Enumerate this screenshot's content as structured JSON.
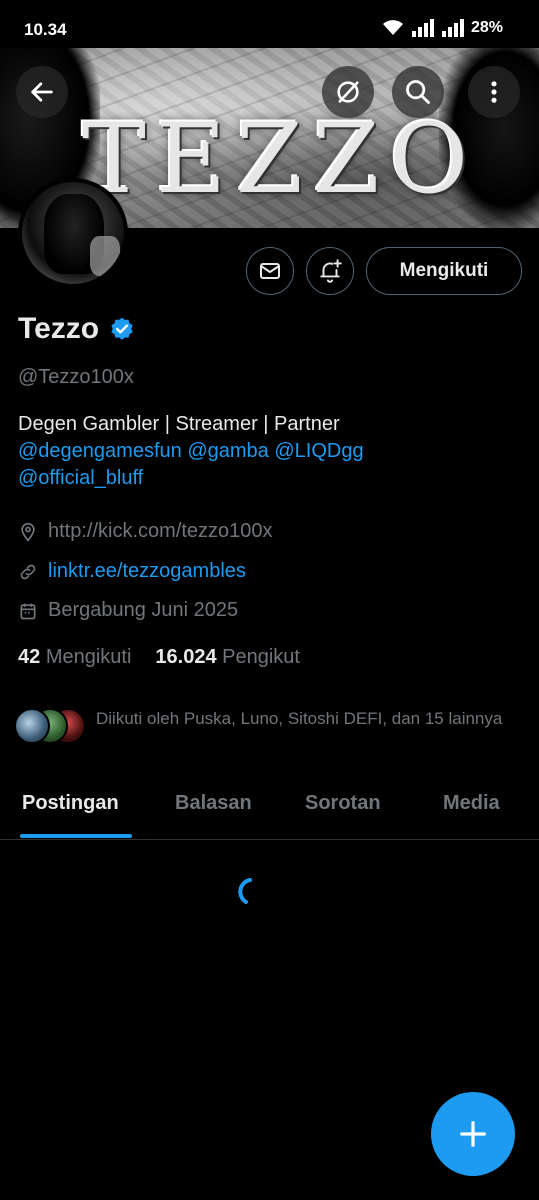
{
  "status_bar": {
    "time": "10.34",
    "battery": "28%"
  },
  "banner": {
    "title": "TEZZO"
  },
  "header": {
    "back_icon": "arrow-left-icon",
    "grok_icon": "grok-icon",
    "search_icon": "search-icon",
    "more_icon": "more-vertical-icon"
  },
  "profile": {
    "name": "Tezzo",
    "verified": true,
    "handle": "@Tezzo100x",
    "follow_button": "Mengikuti",
    "bio_line1": "Degen Gambler | Streamer | Partner",
    "bio_mentions": [
      "@degengamesfun",
      "@gamba",
      "@LIQDgg",
      "@official_bluff"
    ],
    "location_url": "http://kick.com/tezzo100x",
    "website": "linktr.ee/tezzogambles",
    "joined": "Bergabung Juni 2025",
    "following_count": "42",
    "following_label": "Mengikuti",
    "followers_count": "16.024",
    "followers_label": "Pengikut",
    "followed_by": "Diikuti oleh Puska, Luno, Sitoshi DEFI, dan 15 lainnya"
  },
  "tabs": [
    {
      "label": "Postingan",
      "active": true
    },
    {
      "label": "Balasan",
      "active": false
    },
    {
      "label": "Sorotan",
      "active": false
    },
    {
      "label": "Media",
      "active": false
    }
  ],
  "colors": {
    "accent": "#1d9bf0",
    "muted": "#71767b",
    "border": "#2f3336"
  }
}
